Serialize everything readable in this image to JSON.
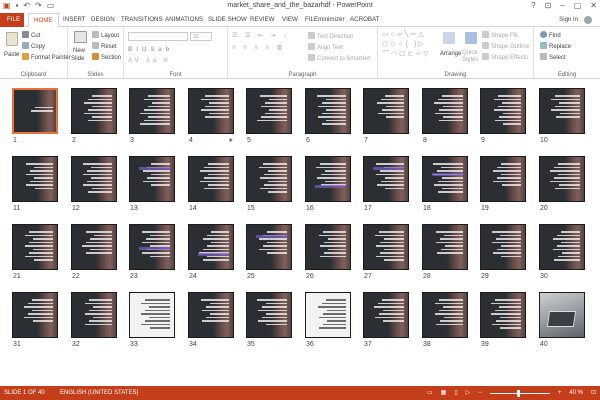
{
  "window": {
    "title": "market_share_and_the_bazarhdf - PowerPoint",
    "help": "?",
    "minimize": "–",
    "maximize": "▢",
    "close": "✕"
  },
  "tabs": [
    "FILE",
    "HOME",
    "INSERT",
    "DESIGN",
    "TRANSITIONS",
    "ANIMATIONS",
    "SLIDE SHOW",
    "REVIEW",
    "VIEW",
    "FILEminimizer",
    "ACROBAT"
  ],
  "active_tab": "HOME",
  "sign_in": "Sign in",
  "ribbon": {
    "clipboard": {
      "label": "Clipboard",
      "paste": "Paste",
      "cut": "Cut",
      "copy": "Copy",
      "format_painter": "Format Painter"
    },
    "slides": {
      "label": "Slides",
      "new_slide": "New",
      "new_slide_2": "Slide",
      "layout": "Layout",
      "reset": "Reset",
      "section": "Section"
    },
    "font": {
      "label": "Font",
      "size": "32"
    },
    "paragraph": {
      "label": "Paragraph",
      "text_direction": "Text Direction",
      "align_text": "Align Text",
      "convert_smartart": "Convert to SmartArt"
    },
    "drawing": {
      "label": "Drawing",
      "arrange": "Arrange",
      "quick_styles": "Quick Styles",
      "shape_fill": "Shape Fill",
      "shape_outline": "Shape Outline",
      "shape_effects": "Shape Effects"
    },
    "editing": {
      "label": "Editing",
      "find": "Find",
      "replace": "Replace",
      "select": "Select"
    }
  },
  "slides": [
    {
      "n": "1"
    },
    {
      "n": "2"
    },
    {
      "n": "3"
    },
    {
      "n": "4"
    },
    {
      "n": "5"
    },
    {
      "n": "6"
    },
    {
      "n": "7"
    },
    {
      "n": "8"
    },
    {
      "n": "9"
    },
    {
      "n": "10"
    },
    {
      "n": "11"
    },
    {
      "n": "12"
    },
    {
      "n": "13"
    },
    {
      "n": "14"
    },
    {
      "n": "15"
    },
    {
      "n": "16"
    },
    {
      "n": "17"
    },
    {
      "n": "18"
    },
    {
      "n": "19"
    },
    {
      "n": "20"
    },
    {
      "n": "21"
    },
    {
      "n": "22"
    },
    {
      "n": "23"
    },
    {
      "n": "24"
    },
    {
      "n": "25"
    },
    {
      "n": "26"
    },
    {
      "n": "27"
    },
    {
      "n": "28"
    },
    {
      "n": "29"
    },
    {
      "n": "30"
    },
    {
      "n": "31"
    },
    {
      "n": "32"
    },
    {
      "n": "33"
    },
    {
      "n": "34"
    },
    {
      "n": "35"
    },
    {
      "n": "36"
    },
    {
      "n": "37"
    },
    {
      "n": "38"
    },
    {
      "n": "39"
    },
    {
      "n": "40"
    }
  ],
  "status": {
    "slide_info": "SLIDE 1 OF 40",
    "language": "ENGLISH (UNITED STATES)",
    "zoom": "40 %"
  },
  "colors": {
    "accent": "#c43e1c",
    "selected_border": "#e9703f"
  }
}
